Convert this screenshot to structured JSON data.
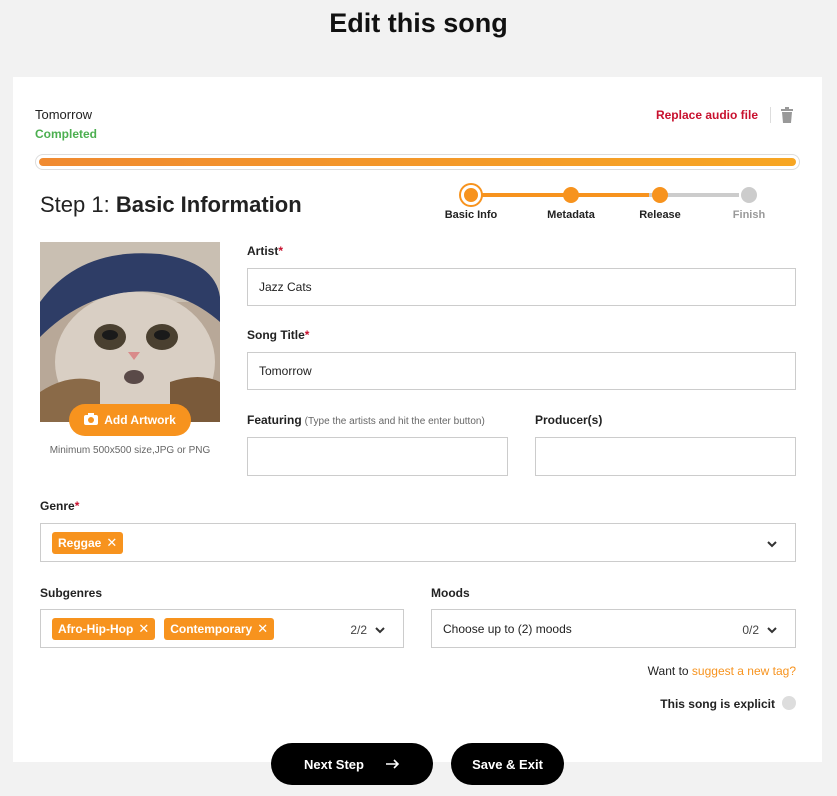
{
  "page": {
    "title": "Edit this song"
  },
  "song": {
    "name": "Tomorrow",
    "status": "Completed",
    "replace_label": "Replace audio file",
    "progress_percent": 100
  },
  "step": {
    "prefix": "Step 1:",
    "title": "Basic Information"
  },
  "stepper": {
    "steps": [
      {
        "label": "Basic Info",
        "state": "current"
      },
      {
        "label": "Metadata",
        "state": "done"
      },
      {
        "label": "Release",
        "state": "done"
      },
      {
        "label": "Finish",
        "state": "todo"
      }
    ]
  },
  "artwork": {
    "button_label": "Add Artwork",
    "hint": "Minimum 500x500 size,JPG or PNG"
  },
  "fields": {
    "artist": {
      "label": "Artist",
      "required": "*",
      "value": "Jazz Cats"
    },
    "song_title": {
      "label": "Song Title",
      "required": "*",
      "value": "Tomorrow"
    },
    "featuring": {
      "label": "Featuring",
      "hint": "(Type the artists and hit the enter button)",
      "value": ""
    },
    "producers": {
      "label": "Producer(s)",
      "value": ""
    },
    "genre": {
      "label": "Genre",
      "required": "*",
      "tags": [
        "Reggae"
      ]
    },
    "subgenres": {
      "label": "Subgenres",
      "tags": [
        "Afro-Hip-Hop",
        "Contemporary"
      ],
      "count": "2/2"
    },
    "moods": {
      "label": "Moods",
      "placeholder": "Choose up to (2) moods",
      "count": "0/2"
    }
  },
  "suggest": {
    "prefix": "Want to",
    "link": "suggest a new tag?"
  },
  "explicit": {
    "label": "This song is explicit",
    "checked": false
  },
  "buttons": {
    "next": "Next Step",
    "save": "Save & Exit"
  },
  "colors": {
    "accent": "#f7931e",
    "danger": "#c8102e",
    "success": "#4caf50",
    "inactive": "#cccccc"
  }
}
